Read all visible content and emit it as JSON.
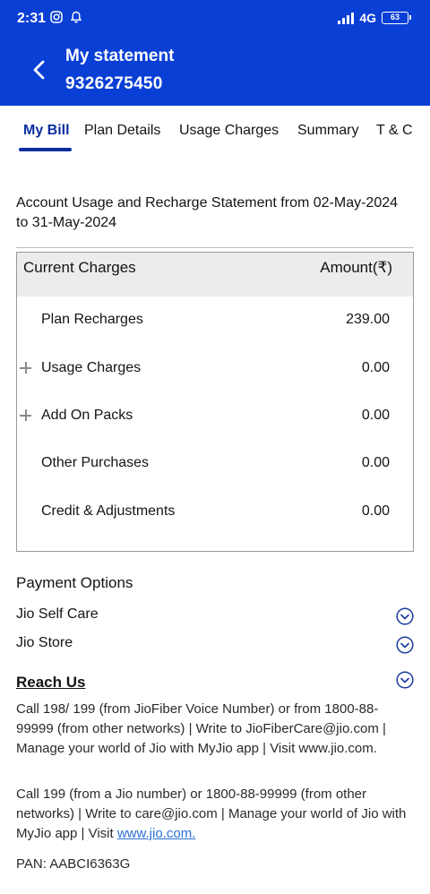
{
  "status_bar": {
    "time": "2:31",
    "network": "4G",
    "battery": "63"
  },
  "header": {
    "title": "My statement",
    "subtitle": "9326275450",
    "color": "#0a3fd6"
  },
  "tabs": [
    {
      "label": "My Bill",
      "active": true
    },
    {
      "label": "Plan Details",
      "active": false
    },
    {
      "label": "Usage Charges",
      "active": false
    },
    {
      "label": "Summary",
      "active": false
    },
    {
      "label": "T & C",
      "active": false
    }
  ],
  "statement": {
    "title": "Account Usage and Recharge Statement from 02-May-2024 to 31-May-2024"
  },
  "charges": {
    "header_left": "Current Charges",
    "header_right": "Amount(₹)",
    "rows": [
      {
        "label": "Plan Recharges",
        "value": "239.00",
        "expandable": false
      },
      {
        "label": "Usage Charges",
        "value": "0.00",
        "expandable": true
      },
      {
        "label": "Add On Packs",
        "value": "0.00",
        "expandable": true
      },
      {
        "label": "Other Purchases",
        "value": "0.00",
        "expandable": false
      },
      {
        "label": "Credit & Adjustments",
        "value": "0.00",
        "expandable": false
      }
    ]
  },
  "payment": {
    "title": "Payment Options",
    "options": [
      {
        "label": "Jio Self Care",
        "icon": "chevron-down-circle-icon"
      },
      {
        "label": "Jio Store",
        "icon": "chevron-down-circle-icon"
      }
    ]
  },
  "reach_us": {
    "title": "Reach Us",
    "para1": "Call 198/ 199 (from JioFiber Voice Number) or from 1800-88-99999 (from other networks) | Write to JioFiberCare@jio.com | Manage your world of Jio with MyJio app | Visit www.jio.com.",
    "para2_text": "Call 199 (from a Jio number) or 1800-88-99999 (from other networks) | Write to care@jio.com | Manage your world of Jio with MyJio app | Visit ",
    "para2_link": "www.jio.com."
  },
  "pan": "PAN: AABCI6363G"
}
